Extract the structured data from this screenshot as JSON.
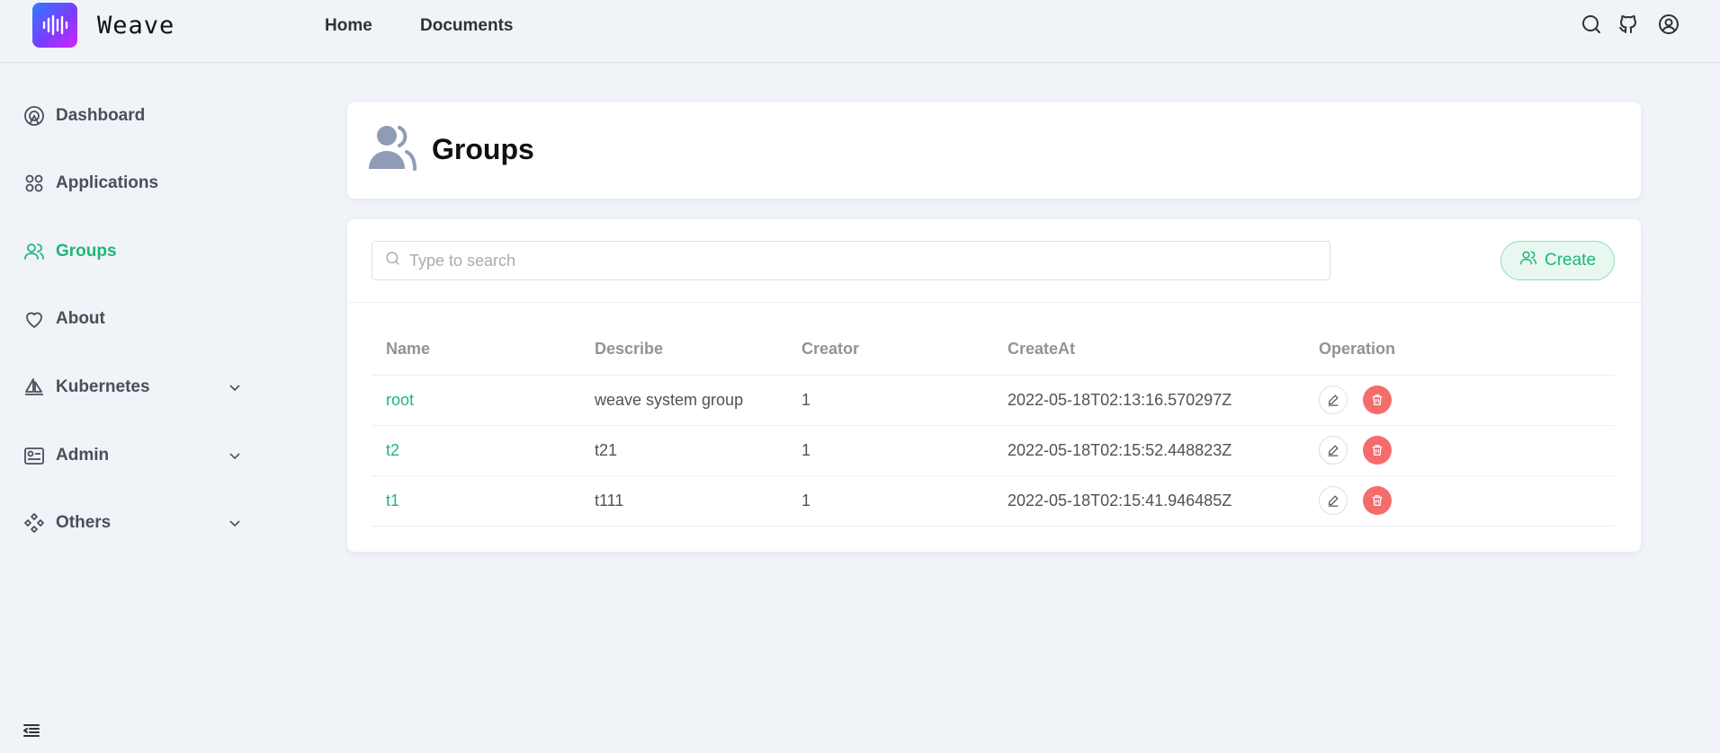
{
  "app": {
    "name": "Weave"
  },
  "header": {
    "nav": [
      "Home",
      "Documents"
    ],
    "icons": [
      "search-icon",
      "github-icon",
      "user-icon"
    ]
  },
  "sidebar": {
    "items": [
      {
        "label": "Dashboard",
        "icon": "dashboard-icon",
        "active": false,
        "expandable": false
      },
      {
        "label": "Applications",
        "icon": "apps-icon",
        "active": false,
        "expandable": false
      },
      {
        "label": "Groups",
        "icon": "users-icon",
        "active": true,
        "expandable": false
      },
      {
        "label": "About",
        "icon": "heart-icon",
        "active": false,
        "expandable": false
      },
      {
        "label": "Kubernetes",
        "icon": "sailboat-icon",
        "active": false,
        "expandable": true
      },
      {
        "label": "Admin",
        "icon": "admin-icon",
        "active": false,
        "expandable": true
      },
      {
        "label": "Others",
        "icon": "others-icon",
        "active": false,
        "expandable": true
      }
    ]
  },
  "page": {
    "title": "Groups"
  },
  "search": {
    "placeholder": "Type to search",
    "value": ""
  },
  "toolbar": {
    "create_label": "Create"
  },
  "table": {
    "columns": [
      "Name",
      "Describe",
      "Creator",
      "CreateAt",
      "Operation"
    ],
    "rows": [
      {
        "name": "root",
        "describe": "weave system group",
        "creator": "1",
        "create_at": "2022-05-18T02:13:16.570297Z"
      },
      {
        "name": "t2",
        "describe": "t21",
        "creator": "1",
        "create_at": "2022-05-18T02:15:52.448823Z"
      },
      {
        "name": "t1",
        "describe": "t111",
        "creator": "1",
        "create_at": "2022-05-18T02:15:41.946485Z"
      }
    ]
  },
  "colors": {
    "accent": "#1fb57a",
    "danger": "#f56c6c",
    "background": "#f0f3f8"
  }
}
